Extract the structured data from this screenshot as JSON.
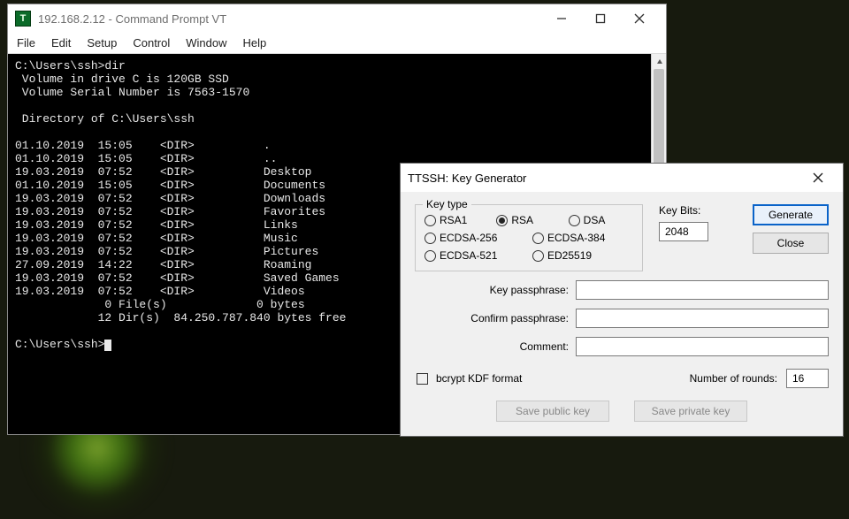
{
  "terminal": {
    "title": "192.168.2.12 - Command Prompt VT",
    "menu": [
      "File",
      "Edit",
      "Setup",
      "Control",
      "Window",
      "Help"
    ],
    "lines": [
      "C:\\Users\\ssh>dir",
      " Volume in drive C is 120GB SSD",
      " Volume Serial Number is 7563-1570",
      "",
      " Directory of C:\\Users\\ssh",
      "",
      "01.10.2019  15:05    <DIR>          .",
      "01.10.2019  15:05    <DIR>          ..",
      "19.03.2019  07:52    <DIR>          Desktop",
      "01.10.2019  15:05    <DIR>          Documents",
      "19.03.2019  07:52    <DIR>          Downloads",
      "19.03.2019  07:52    <DIR>          Favorites",
      "19.03.2019  07:52    <DIR>          Links",
      "19.03.2019  07:52    <DIR>          Music",
      "19.03.2019  07:52    <DIR>          Pictures",
      "27.09.2019  14:22    <DIR>          Roaming",
      "19.03.2019  07:52    <DIR>          Saved Games",
      "19.03.2019  07:52    <DIR>          Videos",
      "             0 File(s)             0 bytes",
      "            12 Dir(s)  84.250.787.840 bytes free",
      "",
      "C:\\Users\\ssh>"
    ]
  },
  "dialog": {
    "title": "TTSSH: Key Generator",
    "keytype_legend": "Key type",
    "radios": {
      "rsa1": "RSA1",
      "rsa": "RSA",
      "dsa": "DSA",
      "ecdsa256": "ECDSA-256",
      "ecdsa384": "ECDSA-384",
      "ecdsa521": "ECDSA-521",
      "ed25519": "ED25519",
      "selected": "rsa"
    },
    "keybits_label": "Key Bits:",
    "keybits_value": "2048",
    "generate_label": "Generate",
    "close_label": "Close",
    "passphrase_label": "Key passphrase:",
    "confirm_label": "Confirm passphrase:",
    "comment_label": "Comment:",
    "bcrypt_label": "bcrypt KDF format",
    "rounds_label": "Number of rounds:",
    "rounds_value": "16",
    "save_pub_label": "Save public key",
    "save_priv_label": "Save private key"
  }
}
